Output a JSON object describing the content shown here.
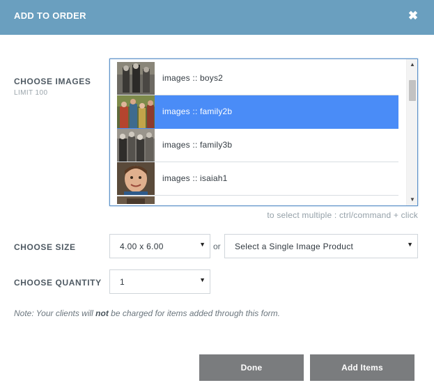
{
  "modal": {
    "title": "ADD TO ORDER"
  },
  "images": {
    "label": "CHOOSE IMAGES",
    "limit": "LIMIT 100",
    "items": [
      {
        "label": "images :: boys2",
        "selected": false
      },
      {
        "label": "images :: family2b",
        "selected": true
      },
      {
        "label": "images :: family3b",
        "selected": false
      },
      {
        "label": "images :: isaiah1",
        "selected": false
      }
    ],
    "hint": "to select multiple : ctrl/command + click"
  },
  "size": {
    "label": "CHOOSE SIZE",
    "value": "4.00 x 6.00",
    "or": "or",
    "product_value": "Select a Single Image Product"
  },
  "quantity": {
    "label": "CHOOSE QUANTITY",
    "value": "1"
  },
  "note": {
    "before": "Note: Your clients will ",
    "emphasis": "not",
    "after": " be charged for items added through this form."
  },
  "buttons": {
    "done": "Done",
    "add": "Add Items"
  },
  "colors": {
    "header": "#6a9fbf",
    "selection": "#4a8cf7",
    "button": "#7a7c7e"
  },
  "icons": {
    "close": "close-icon",
    "caret": "caret-down-icon",
    "scroll_up": "scroll-up-icon",
    "scroll_down": "scroll-down-icon"
  }
}
